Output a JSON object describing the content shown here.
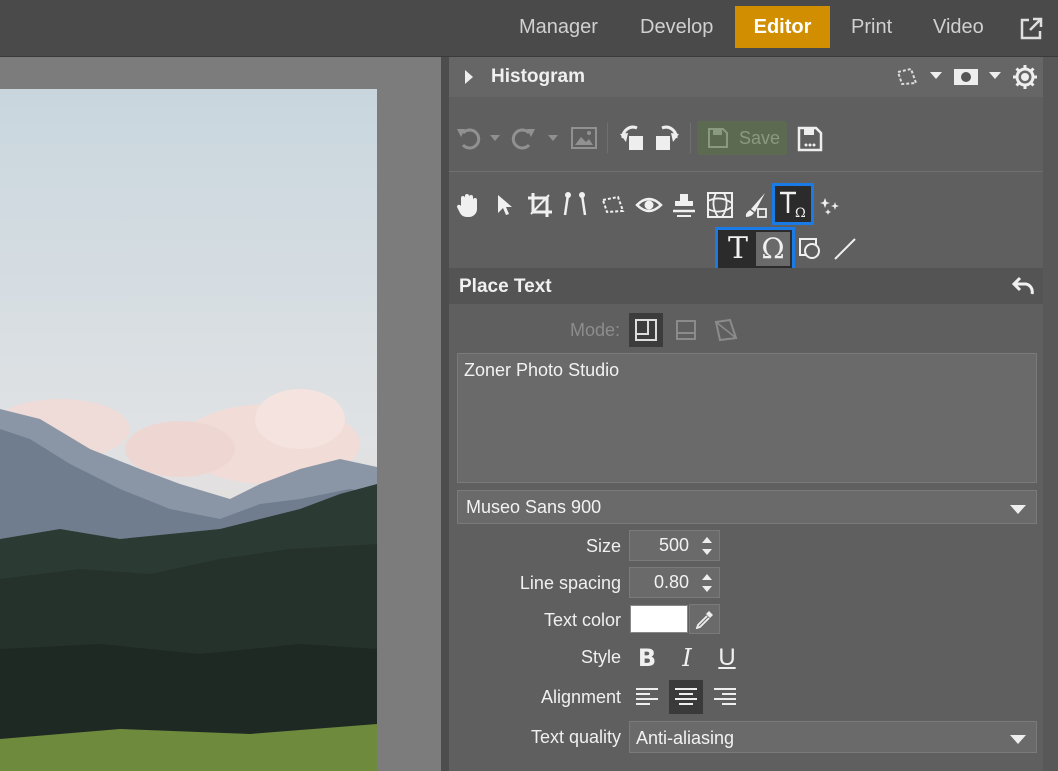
{
  "nav": {
    "tabs": [
      {
        "label": "Manager",
        "active": false
      },
      {
        "label": "Develop",
        "active": false
      },
      {
        "label": "Editor",
        "active": true
      },
      {
        "label": "Print",
        "active": false
      },
      {
        "label": "Video",
        "active": false
      }
    ],
    "external_icon": "external-window-icon"
  },
  "histogram": {
    "title": "Histogram"
  },
  "toolbar": {
    "save_label": "Save"
  },
  "place_text": {
    "title": "Place Text",
    "mode_label": "Mode:",
    "text_value": "Zoner Photo Studio",
    "font": "Museo Sans 900",
    "size_label": "Size",
    "size_value": "500",
    "line_spacing_label": "Line spacing",
    "line_spacing_value": "0.80",
    "text_color_label": "Text color",
    "text_color": "#ffffff",
    "style_label": "Style",
    "style_bold": "B",
    "style_italic": "I",
    "style_underline": "U",
    "alignment_label": "Alignment",
    "alignment_selected": "center",
    "text_quality_label": "Text quality",
    "text_quality_value": "Anti-aliasing"
  },
  "colors": {
    "accent_active_tab": "#d08e00",
    "tool_highlight": "#1a7ae6"
  }
}
